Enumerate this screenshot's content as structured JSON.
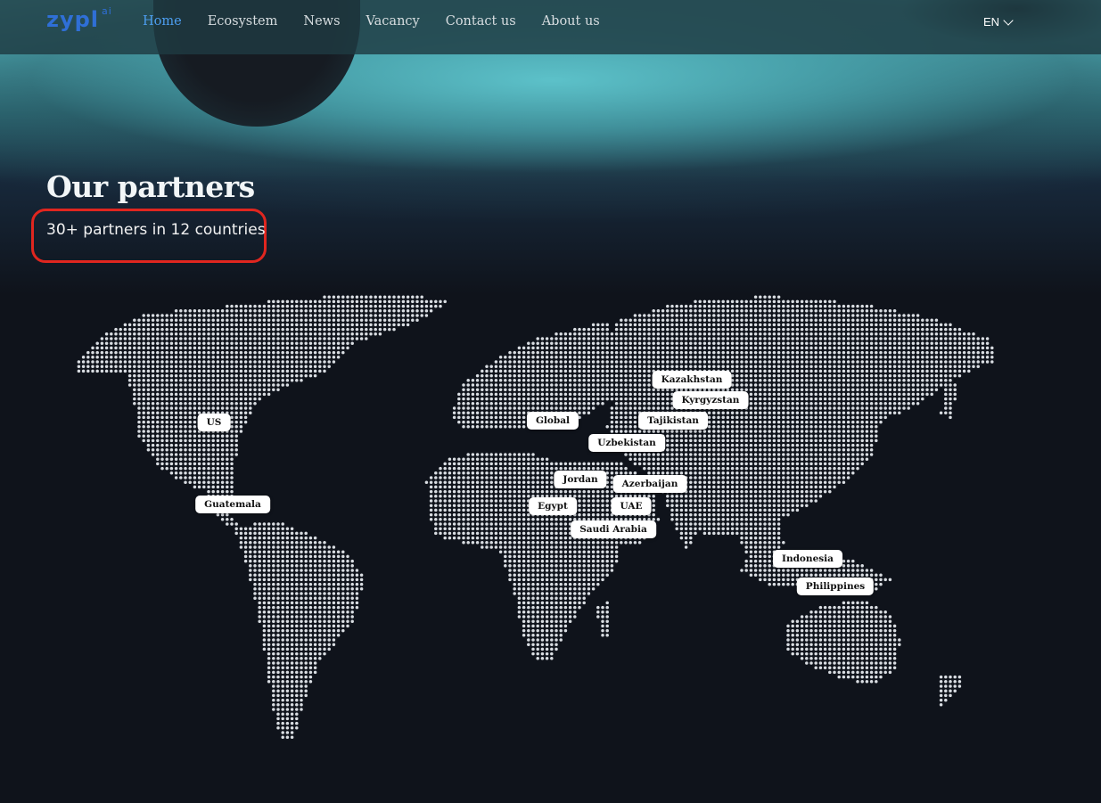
{
  "brand": {
    "logo_text": "zypl",
    "logo_sup": "ai",
    "color": "#2f6fd6"
  },
  "nav": {
    "items": [
      {
        "label": "Home",
        "active": true
      },
      {
        "label": "Ecosystem",
        "active": false
      },
      {
        "label": "News",
        "active": false
      },
      {
        "label": "Vacancy",
        "active": false
      },
      {
        "label": "Contact us",
        "active": false
      },
      {
        "label": "About us",
        "active": false
      }
    ],
    "language": "EN"
  },
  "hero": {
    "title": "Our partners",
    "subtitle": "30+ partners in 12 countries",
    "highlight_color": "#e0261f"
  },
  "map": {
    "dot_color": "#d9dde2",
    "country_tags": [
      "US",
      "Guatemala",
      "Global",
      "Kazakhstan",
      "Kyrgyzstan",
      "Tajikistan",
      "Uzbekistan",
      "Jordan",
      "Azerbaijan",
      "Egypt",
      "UAE",
      "Saudi Arabia",
      "Indonesia",
      "Philippines"
    ]
  }
}
